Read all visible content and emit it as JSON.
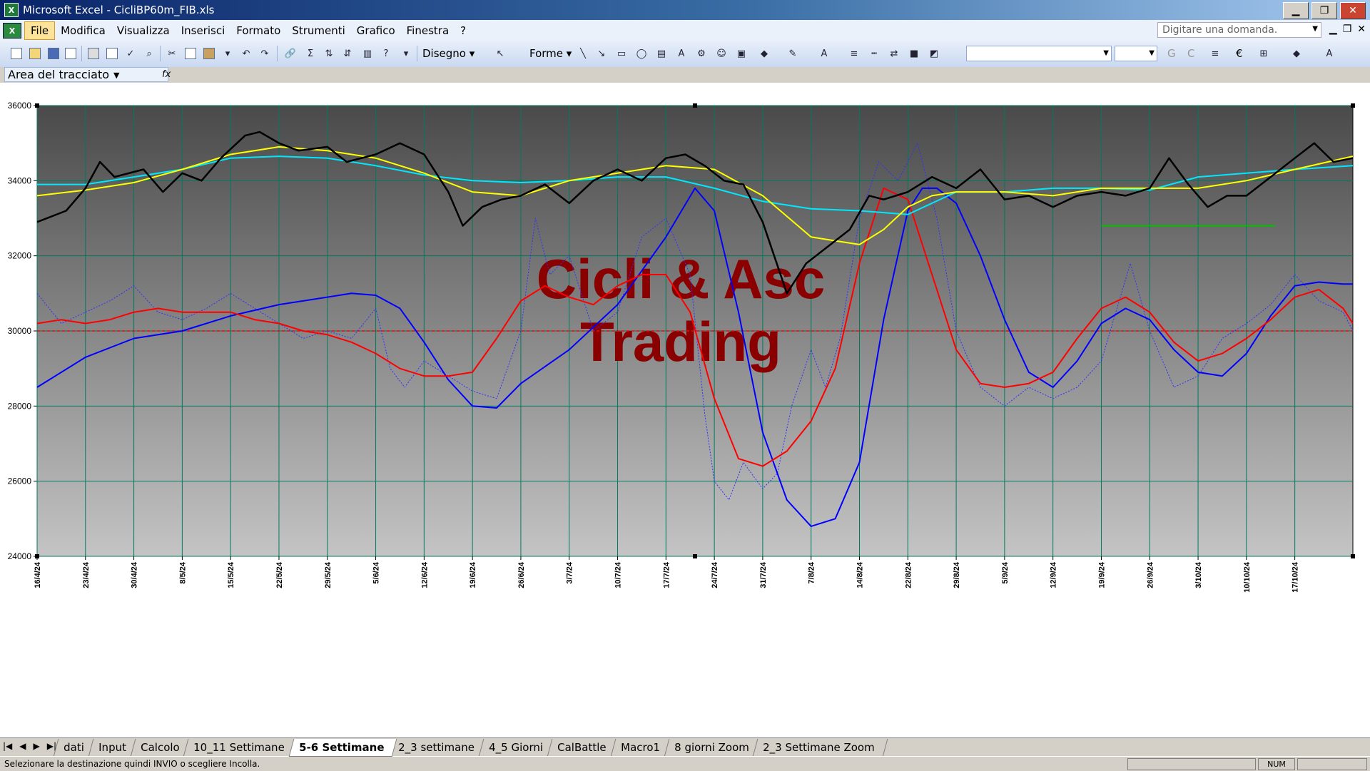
{
  "window": {
    "title": "Microsoft Excel - CicliBP60m_FIB.xls",
    "min_glyph": "▁",
    "max_glyph": "❐",
    "close_glyph": "✕"
  },
  "menu": {
    "items": [
      "File",
      "Modifica",
      "Visualizza",
      "Inserisci",
      "Formato",
      "Strumenti",
      "Grafico",
      "Finestra",
      "?"
    ],
    "active": "File",
    "help_placeholder": "Digitare una domanda."
  },
  "toolbar": {
    "draw_label": "Disegno",
    "shapes_label": "Forme",
    "bold_label": "G",
    "italic_label": "C",
    "euro_label": "€"
  },
  "namebox": {
    "value": "Area del tracciato",
    "fx": "fx"
  },
  "chart_data": {
    "type": "line",
    "ylim": [
      24000,
      36000
    ],
    "yticks": [
      24000,
      26000,
      28000,
      30000,
      32000,
      34000,
      36000
    ],
    "ytick_labels": [
      "24000",
      "26000",
      "28000",
      "30000",
      "32000",
      "34000",
      "36000"
    ],
    "xlim": [
      0,
      27.2
    ],
    "x_labels": [
      "16/4/24",
      "23/4/24",
      "30/4/24",
      "8/5/24",
      "15/5/24",
      "22/5/24",
      "29/5/24",
      "5/6/24",
      "12/6/24",
      "19/6/24",
      "26/6/24",
      "3/7/24",
      "10/7/24",
      "17/7/24",
      "24/7/24",
      "31/7/24",
      "7/8/24",
      "14/8/24",
      "22/8/24",
      "29/8/24",
      "5/9/24",
      "12/9/24",
      "19/9/24",
      "26/9/24",
      "3/10/24",
      "10/10/24",
      "17/10/24"
    ],
    "watermark": [
      "Cicli & Asc",
      "Trading"
    ],
    "hline": {
      "y": 30000,
      "color": "#ff0000"
    },
    "green_level": {
      "x": [
        22.0,
        25.6
      ],
      "y": 32800,
      "color": "#00c000"
    },
    "series": [
      {
        "key": "price",
        "color": "#000000",
        "width": 2.5,
        "x": [
          0,
          0.6,
          1,
          1.3,
          1.6,
          2.2,
          2.6,
          3,
          3.4,
          3.8,
          4.3,
          4.6,
          5,
          5.4,
          6,
          6.4,
          7,
          7.5,
          8,
          8.5,
          8.8,
          9.2,
          9.6,
          10,
          10.5,
          11,
          11.5,
          12,
          12.5,
          13,
          13.4,
          13.8,
          14.2,
          14.6,
          15,
          15.5,
          15.9,
          16.2,
          16.5,
          16.8,
          17.2,
          17.5,
          18,
          18.5,
          19,
          19.5,
          20,
          20.5,
          21,
          21.5,
          22,
          22.5,
          23,
          23.4,
          23.8,
          24.2,
          24.6,
          25,
          25.5,
          26,
          26.4,
          26.8,
          27.2
        ],
        "y": [
          32900,
          33200,
          33800,
          34500,
          34100,
          34300,
          33700,
          34200,
          34000,
          34600,
          35200,
          35300,
          35000,
          34800,
          34900,
          34500,
          34700,
          35000,
          34700,
          33700,
          32800,
          33300,
          33500,
          33600,
          33900,
          33400,
          34000,
          34300,
          34000,
          34600,
          34700,
          34400,
          34000,
          33900,
          32900,
          31000,
          31800,
          32100,
          32400,
          32700,
          33600,
          33500,
          33700,
          34100,
          33800,
          34300,
          33500,
          33600,
          33300,
          33600,
          33700,
          33600,
          33800,
          34600,
          33900,
          33300,
          33600,
          33600,
          34100,
          34600,
          35000,
          34500,
          34600
        ]
      },
      {
        "key": "sma_fast",
        "color": "#ffff00",
        "width": 2,
        "x": [
          0,
          1,
          2,
          3,
          4,
          5,
          6,
          7,
          8,
          9,
          10,
          11,
          12,
          13,
          14,
          15,
          16,
          16.5,
          17,
          17.5,
          18,
          18.5,
          19,
          20,
          21,
          22,
          23,
          24,
          25,
          26,
          27.2
        ],
        "y": [
          33600,
          33750,
          33950,
          34300,
          34700,
          34900,
          34800,
          34600,
          34200,
          33700,
          33600,
          34000,
          34200,
          34400,
          34300,
          33600,
          32500,
          32400,
          32300,
          32700,
          33300,
          33600,
          33700,
          33700,
          33600,
          33800,
          33800,
          33800,
          34000,
          34300,
          34650
        ]
      },
      {
        "key": "sma_slow",
        "color": "#00e8ff",
        "width": 2,
        "x": [
          0,
          1,
          2,
          3,
          4,
          5,
          6,
          7,
          8,
          9,
          10,
          11,
          12,
          13,
          14,
          15,
          16,
          17,
          18,
          19,
          20,
          21,
          22,
          23,
          24,
          25,
          26,
          27.2
        ],
        "y": [
          33900,
          33900,
          34100,
          34300,
          34600,
          34650,
          34600,
          34400,
          34150,
          34000,
          33950,
          34000,
          34100,
          34100,
          33800,
          33450,
          33250,
          33200,
          33100,
          33700,
          33700,
          33800,
          33800,
          33750,
          34100,
          34200,
          34300,
          34400
        ]
      },
      {
        "key": "osc_dotted",
        "color": "#3030ff",
        "width": 1,
        "dashed": true,
        "x": [
          0,
          0.5,
          1,
          1.5,
          2,
          2.5,
          3,
          3.5,
          4,
          4.5,
          5,
          5.5,
          6,
          6.5,
          7,
          7.3,
          7.6,
          8,
          8.5,
          9,
          9.5,
          10,
          10.3,
          10.6,
          11,
          11.5,
          12,
          12.5,
          13,
          13.5,
          13.8,
          14,
          14.3,
          14.6,
          15,
          15.3,
          15.6,
          16,
          16.3,
          16.6,
          17,
          17.4,
          17.8,
          18.2,
          18.6,
          19,
          19.5,
          20,
          20.5,
          21,
          21.5,
          22,
          22.3,
          22.6,
          23,
          23.5,
          24,
          24.5,
          25,
          25.5,
          26,
          26.5,
          27,
          27.2
        ],
        "y": [
          31000,
          30200,
          30500,
          30800,
          31200,
          30500,
          30300,
          30600,
          31000,
          30600,
          30200,
          29800,
          30000,
          29800,
          30600,
          29000,
          28500,
          29200,
          28800,
          28400,
          28200,
          30000,
          33000,
          31500,
          32000,
          30000,
          30500,
          32500,
          33000,
          31500,
          27800,
          26000,
          25500,
          26500,
          25800,
          26200,
          28000,
          29500,
          28500,
          29800,
          33000,
          34500,
          34000,
          35000,
          33000,
          30000,
          28500,
          28000,
          28500,
          28200,
          28500,
          29200,
          30500,
          31800,
          30000,
          28500,
          28800,
          29800,
          30200,
          30700,
          31500,
          30800,
          30500,
          30000
        ]
      },
      {
        "key": "cycle_blue",
        "color": "#0000ff",
        "width": 2,
        "x": [
          0,
          1,
          2,
          3,
          4,
          5,
          6,
          6.5,
          7,
          7.5,
          8,
          8.5,
          9,
          9.5,
          10,
          11,
          12,
          13,
          13.6,
          14,
          14.5,
          15,
          15.5,
          16,
          16.5,
          17,
          17.5,
          18,
          18.3,
          18.6,
          19,
          19.5,
          20,
          20.5,
          21,
          21.5,
          22,
          22.5,
          23,
          23.5,
          24,
          24.5,
          25,
          25.5,
          26,
          26.5,
          27,
          27.2
        ],
        "y": [
          28500,
          29300,
          29800,
          30000,
          30400,
          30700,
          30900,
          31000,
          30950,
          30600,
          29700,
          28700,
          28000,
          27950,
          28600,
          29500,
          30700,
          32500,
          33800,
          33200,
          30500,
          27300,
          25500,
          24800,
          25000,
          26500,
          30300,
          33200,
          33800,
          33800,
          33400,
          32000,
          30300,
          28900,
          28500,
          29200,
          30200,
          30600,
          30300,
          29500,
          28900,
          28800,
          29400,
          30400,
          31200,
          31300,
          31250,
          31250
        ]
      },
      {
        "key": "cycle_red",
        "color": "#ff0000",
        "width": 2,
        "x": [
          0,
          0.5,
          1,
          1.5,
          2,
          2.5,
          3,
          3.5,
          4,
          4.5,
          5,
          5.5,
          6,
          6.5,
          7,
          7.5,
          8,
          8.5,
          9,
          9.5,
          10,
          10.5,
          11,
          11.5,
          12,
          12.5,
          13,
          13.5,
          14,
          14.5,
          15,
          15.5,
          16,
          16.5,
          17,
          17.5,
          18,
          18.5,
          19,
          19.5,
          20,
          20.5,
          21,
          21.5,
          22,
          22.5,
          23,
          23.5,
          24,
          24.5,
          25,
          25.5,
          26,
          26.5,
          27,
          27.2
        ],
        "y": [
          30200,
          30300,
          30200,
          30300,
          30500,
          30600,
          30500,
          30500,
          30500,
          30300,
          30200,
          30000,
          29900,
          29700,
          29400,
          29000,
          28800,
          28800,
          28900,
          29800,
          30800,
          31200,
          30900,
          30700,
          31200,
          31500,
          31500,
          30500,
          28200,
          26600,
          26400,
          26800,
          27600,
          29000,
          31800,
          33800,
          33500,
          31500,
          29500,
          28600,
          28500,
          28600,
          28900,
          29800,
          30600,
          30900,
          30500,
          29700,
          29200,
          29400,
          29800,
          30300,
          30900,
          31100,
          30600,
          30200
        ]
      }
    ]
  },
  "sheet_tabs": [
    "dati",
    "Input",
    "Calcolo",
    "10_11 Settimane",
    "5-6 Settimane",
    "2_3 settimane",
    "4_5 Giorni",
    "CalBattle",
    "Macro1",
    "8 giorni Zoom",
    "2_3 Settimane Zoom"
  ],
  "active_tab": "5-6 Settimane",
  "status": {
    "message": "Selezionare la destinazione quindi INVIO o scegliere Incolla.",
    "num": "NUM"
  }
}
